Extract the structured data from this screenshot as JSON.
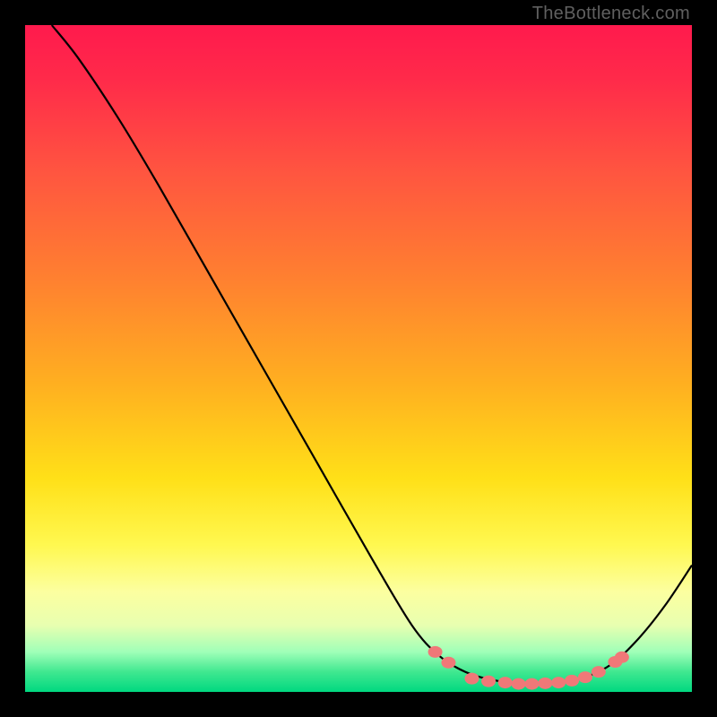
{
  "watermark": "TheBottleneck.com",
  "chart_data": {
    "type": "line",
    "title": "",
    "xlabel": "",
    "ylabel": "",
    "xlim": [
      0,
      100
    ],
    "ylim": [
      0,
      100
    ],
    "curve": [
      {
        "x": 4,
        "y": 100
      },
      {
        "x": 8,
        "y": 95
      },
      {
        "x": 14,
        "y": 86
      },
      {
        "x": 20,
        "y": 76
      },
      {
        "x": 28,
        "y": 62
      },
      {
        "x": 36,
        "y": 48
      },
      {
        "x": 44,
        "y": 34
      },
      {
        "x": 52,
        "y": 20
      },
      {
        "x": 58,
        "y": 10
      },
      {
        "x": 62,
        "y": 5.5
      },
      {
        "x": 66,
        "y": 3
      },
      {
        "x": 70,
        "y": 1.8
      },
      {
        "x": 75,
        "y": 1.2
      },
      {
        "x": 80,
        "y": 1.4
      },
      {
        "x": 84,
        "y": 2.2
      },
      {
        "x": 88,
        "y": 4.2
      },
      {
        "x": 92,
        "y": 8
      },
      {
        "x": 96,
        "y": 13
      },
      {
        "x": 100,
        "y": 19
      }
    ],
    "markers": [
      {
        "x": 61.5,
        "y": 6.0
      },
      {
        "x": 63.5,
        "y": 4.4
      },
      {
        "x": 67.0,
        "y": 2.0
      },
      {
        "x": 69.5,
        "y": 1.6
      },
      {
        "x": 72.0,
        "y": 1.4
      },
      {
        "x": 74.0,
        "y": 1.2
      },
      {
        "x": 76.0,
        "y": 1.2
      },
      {
        "x": 78.0,
        "y": 1.3
      },
      {
        "x": 80.0,
        "y": 1.4
      },
      {
        "x": 82.0,
        "y": 1.7
      },
      {
        "x": 84.0,
        "y": 2.2
      },
      {
        "x": 86.0,
        "y": 3.0
      },
      {
        "x": 88.5,
        "y": 4.5
      },
      {
        "x": 89.5,
        "y": 5.2
      }
    ],
    "gradient_description": "vertical red-to-green heatmap background"
  }
}
